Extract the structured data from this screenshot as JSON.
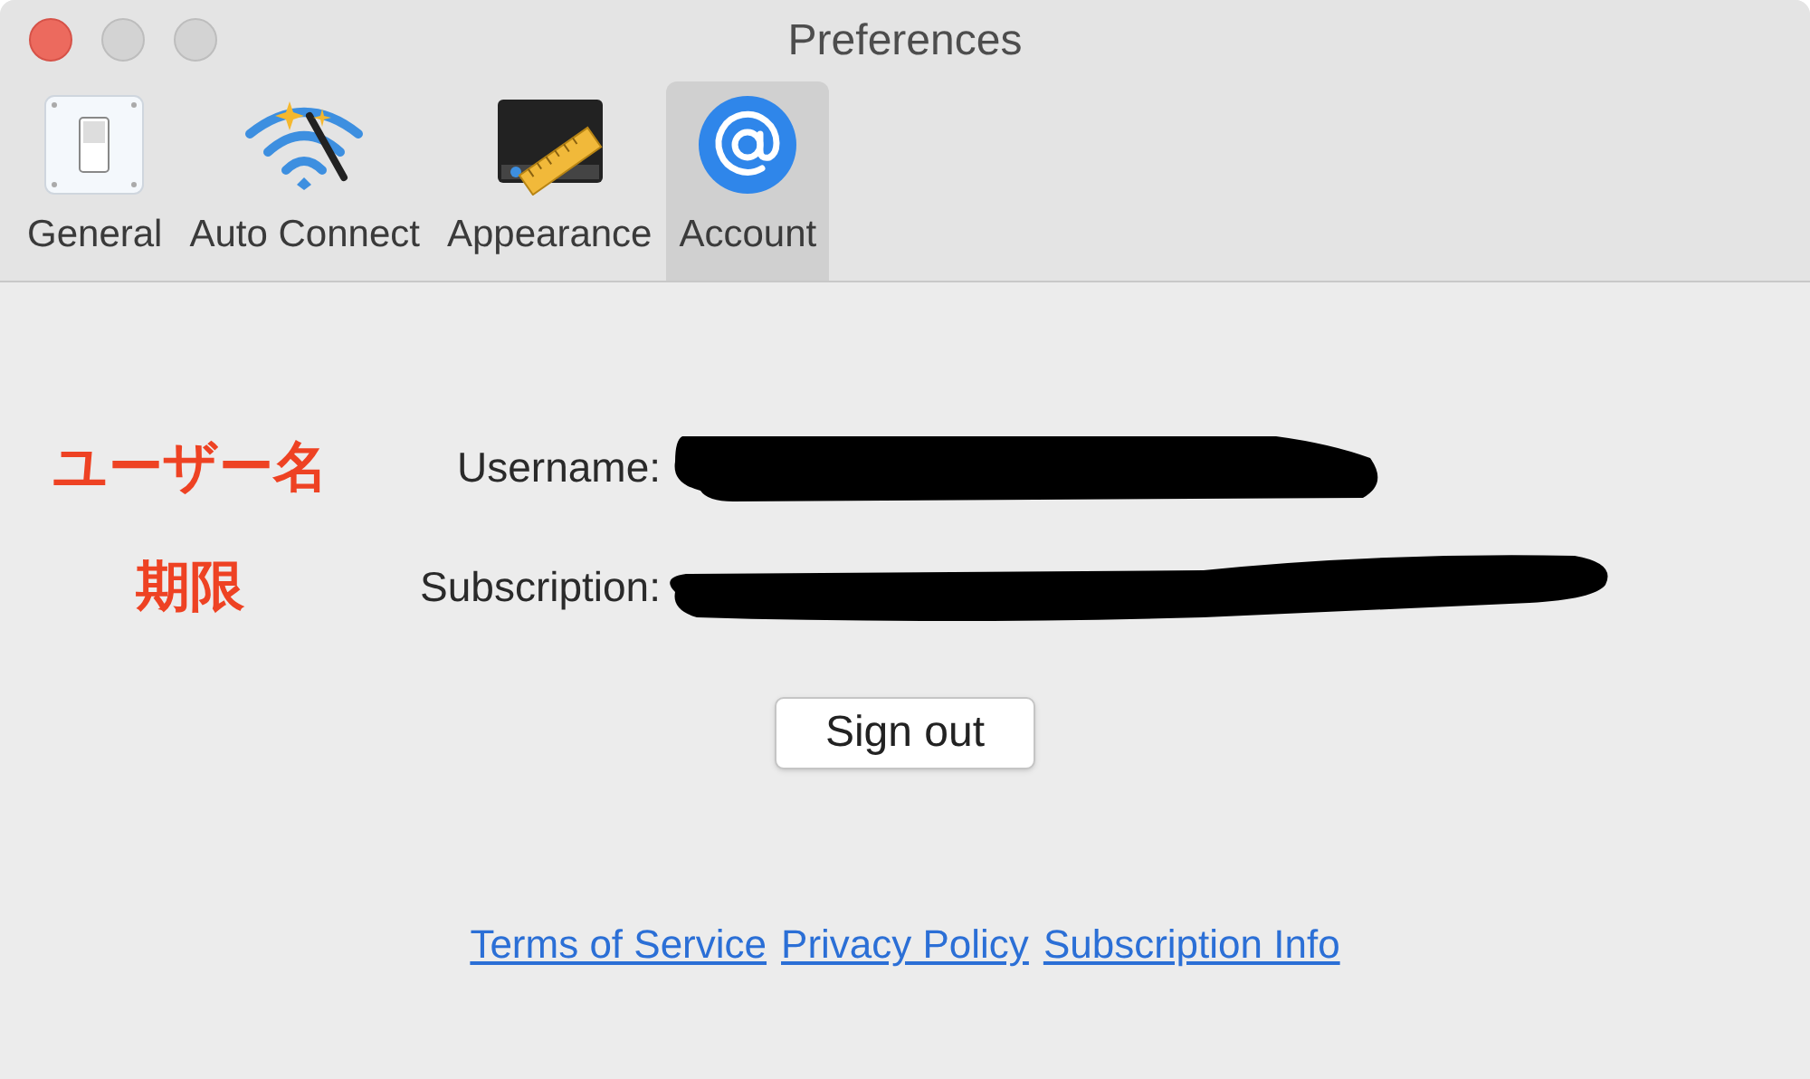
{
  "window": {
    "title": "Preferences"
  },
  "tabs": [
    {
      "label": "General",
      "kind": "switch",
      "selected": false
    },
    {
      "label": "Auto Connect",
      "kind": "wifi",
      "selected": false
    },
    {
      "label": "Appearance",
      "kind": "ruler",
      "selected": false
    },
    {
      "label": "Account",
      "kind": "at",
      "selected": true
    }
  ],
  "fields": [
    {
      "annotation": "ユーザー名",
      "label": "Username:"
    },
    {
      "annotation": "期限",
      "label": "Subscription:"
    }
  ],
  "sign_out_button": "Sign out",
  "links": [
    "Terms of Service",
    "Privacy Policy",
    "Subscription Info"
  ]
}
